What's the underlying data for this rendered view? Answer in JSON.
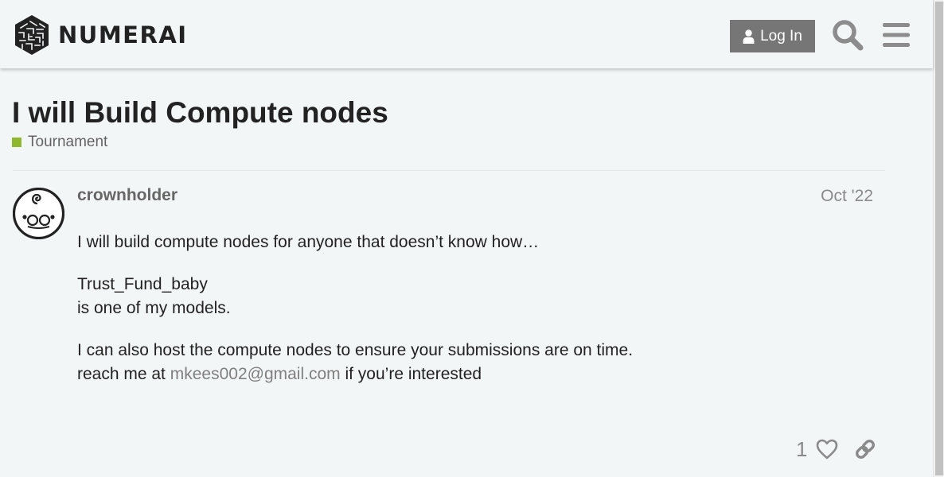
{
  "header": {
    "brand_name": "NUMERAI",
    "login_label": "Log In",
    "icons": {
      "logo": "numerai-cube-logo",
      "user": "user-icon",
      "search": "search-icon",
      "menu": "hamburger-menu-icon"
    }
  },
  "topic": {
    "title": "I will Build Compute nodes",
    "category": "Tournament",
    "category_color": "#8fb82f"
  },
  "post": {
    "username": "crownholder",
    "date": "Oct '22",
    "paragraphs": {
      "p1": "I will build compute nodes for anyone that doesn’t know how…",
      "p2_line1": "Trust_Fund_baby",
      "p2_line2": "is one of my models.",
      "p3_line1": "I can also host the compute nodes to ensure your submissions are on time.",
      "p3_line2_prefix": "reach me at ",
      "email": "mkees002@gmail.com",
      "p3_line2_suffix": " if you’re interested"
    },
    "like_count": "1",
    "icons": {
      "avatar": "baby-face-avatar",
      "like": "heart-icon",
      "share": "link-icon"
    }
  }
}
